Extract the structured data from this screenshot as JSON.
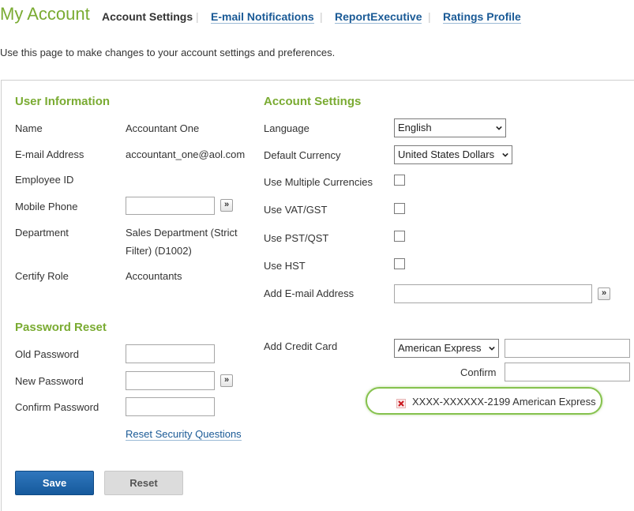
{
  "header": {
    "title": "My Account",
    "tabs": [
      {
        "label": "Account Settings",
        "active": true
      },
      {
        "label": "E-mail Notifications",
        "active": false
      },
      {
        "label": "ReportExecutive",
        "active": false
      },
      {
        "label": "Ratings Profile",
        "active": false
      }
    ],
    "separator": "|",
    "intro": "Use this page to make changes to your account settings and preferences."
  },
  "user_info": {
    "heading": "User Information",
    "name_label": "Name",
    "name_value": "Accountant One",
    "email_label": "E-mail Address",
    "email_value": "accountant_one@aol.com",
    "employee_id_label": "Employee ID",
    "employee_id_value": "",
    "mobile_label": "Mobile Phone",
    "mobile_value": "",
    "department_label": "Department",
    "department_line1": "Sales Department (Strict",
    "department_line2": "Filter) (D1002)",
    "certify_label": "Certify Role",
    "certify_value": "Accountants"
  },
  "password_reset": {
    "heading": "Password Reset",
    "old_label": "Old Password",
    "new_label": "New Password",
    "confirm_label": "Confirm Password",
    "reset_questions_link": "Reset Security Questions"
  },
  "account_settings": {
    "heading": "Account Settings",
    "language_label": "Language",
    "language_value": "English",
    "currency_label": "Default Currency",
    "currency_value": "United States Dollars",
    "multi_currency_label": "Use Multiple Currencies",
    "vat_label": "Use VAT/GST",
    "pst_label": "Use PST/QST",
    "hst_label": "Use HST",
    "add_email_label": "Add E-mail Address",
    "add_email_value": "",
    "add_card_label": "Add Credit Card",
    "card_type_value": "American Express",
    "confirm_label": "Confirm",
    "saved_card": "XXXX-XXXXXX-2199 American Express"
  },
  "buttons": {
    "save": "Save",
    "reset": "Reset"
  },
  "icons": {
    "go": "double-chevron-right-icon",
    "remove": "red-x-icon",
    "dropdown": "chevron-down-icon"
  },
  "colors": {
    "accent_green": "#7aab32",
    "link_blue": "#1a5a96",
    "save_blue": "#1f67ad",
    "chip_green": "#86c24e",
    "remove_red": "#c8161d"
  }
}
